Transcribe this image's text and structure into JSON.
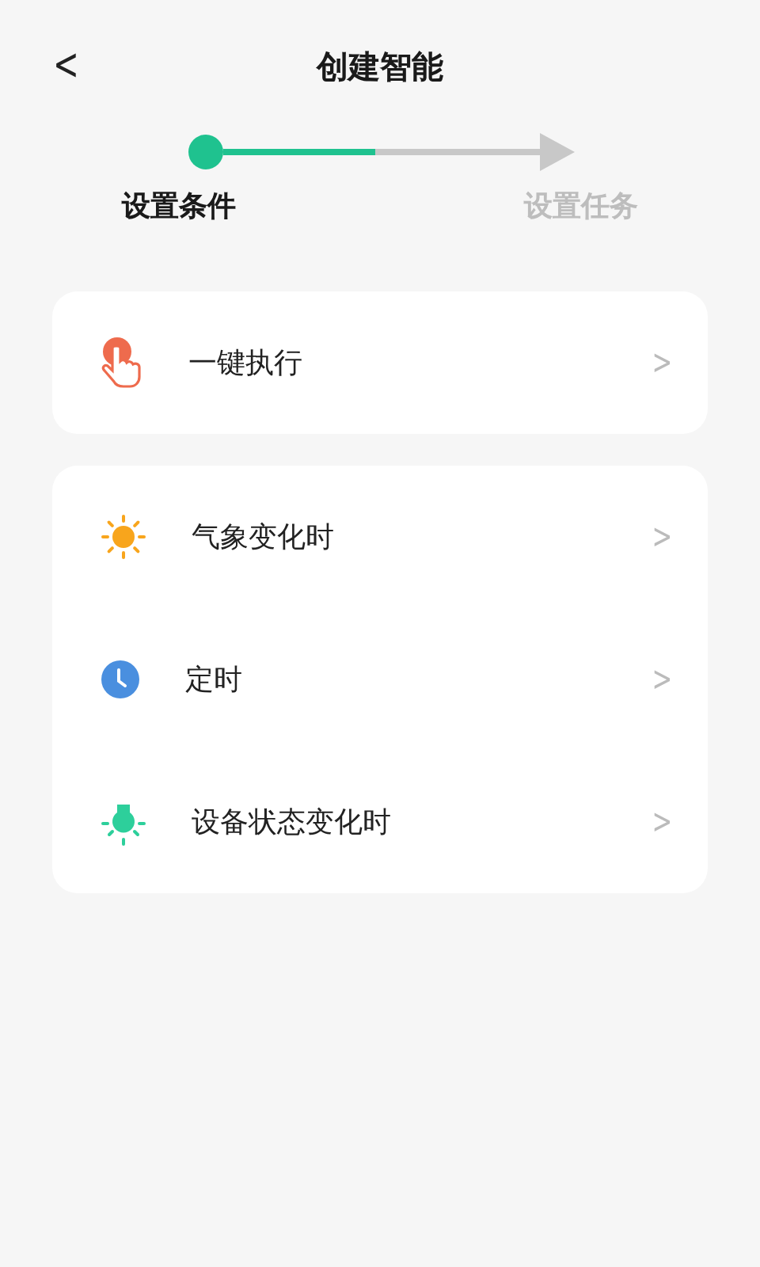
{
  "header": {
    "back": "<",
    "title": "创建智能"
  },
  "steps": {
    "level": 0.48,
    "items": [
      {
        "label": "设置条件",
        "selected": true
      },
      {
        "label": "设置任务",
        "selected": false
      }
    ]
  },
  "groups": [
    {
      "items": [
        {
          "kind": "tap",
          "label": "一键执行",
          "chevron": ">"
        }
      ]
    },
    {
      "items": [
        {
          "kind": "weather",
          "label": "气象变化时",
          "chevron": ">"
        },
        {
          "kind": "timer",
          "label": "定时",
          "chevron": ">"
        },
        {
          "kind": "device",
          "label": "设备状态变化时",
          "chevron": ">"
        }
      ]
    }
  ]
}
